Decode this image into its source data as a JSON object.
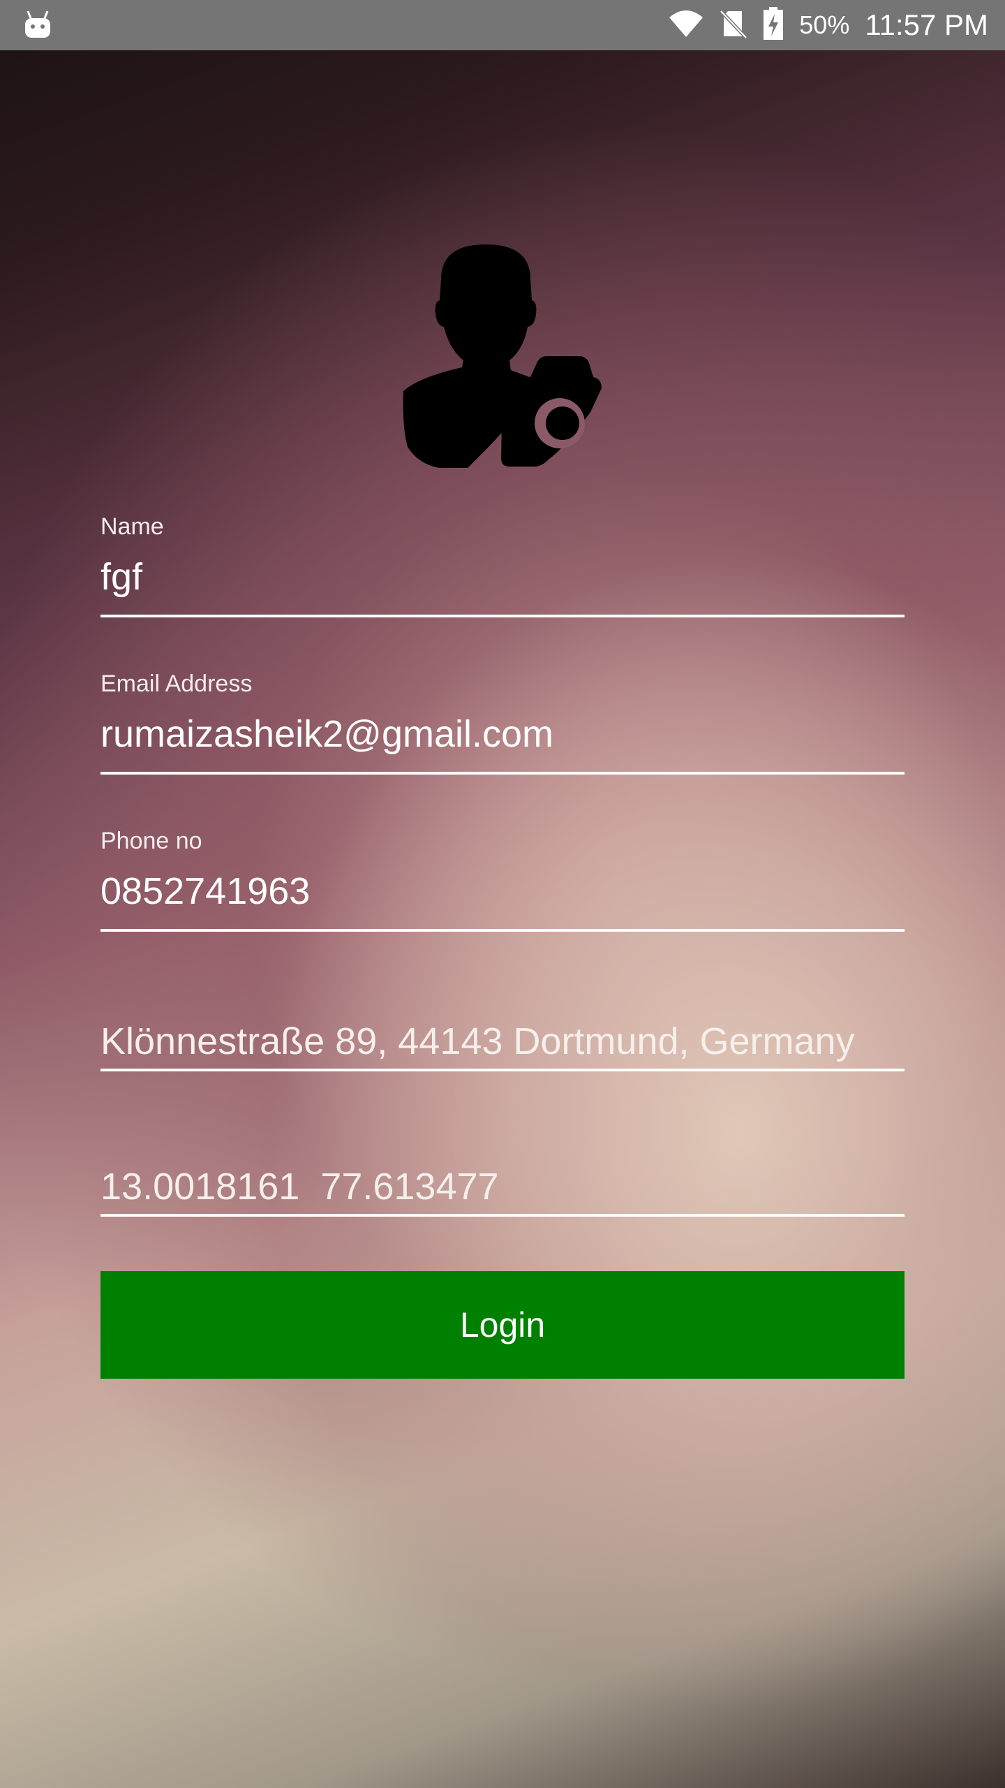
{
  "status_bar": {
    "app_icon": "android-icon",
    "wifi_icon": "wifi-icon",
    "sim_icon": "no-sim-icon",
    "battery_icon": "battery-charging-icon",
    "battery_percent": "50%",
    "time": "11:57 PM"
  },
  "profile": {
    "avatar_icon": "user-camera-icon"
  },
  "form": {
    "name": {
      "label": "Name",
      "value": "fgf"
    },
    "email": {
      "label": "Email Address",
      "value": "rumaizasheik2@gmail.com"
    },
    "phone": {
      "label": "Phone no",
      "value": "0852741963"
    },
    "address": {
      "value": "Klönnestraße 89, 44143 Dortmund, Germany"
    },
    "coordinates": {
      "value": "13.0018161  77.613477"
    },
    "login_label": "Login"
  },
  "colors": {
    "status_bar": "#757575",
    "login_button": "#008000",
    "text": "#ffffff"
  }
}
